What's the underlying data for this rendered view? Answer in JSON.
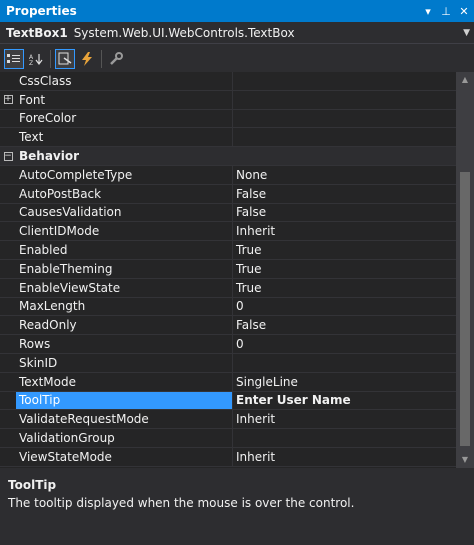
{
  "window": {
    "title": "Properties"
  },
  "object": {
    "name": "TextBox1",
    "type": "System.Web.UI.WebControls.TextBox"
  },
  "rows": [
    {
      "name": "CssClass",
      "value": ""
    },
    {
      "name": "Font",
      "value": "",
      "expandable": true
    },
    {
      "name": "ForeColor",
      "value": ""
    },
    {
      "name": "Text",
      "value": ""
    },
    {
      "name": "Behavior",
      "value": "",
      "category": true
    },
    {
      "name": "AutoCompleteType",
      "value": "None"
    },
    {
      "name": "AutoPostBack",
      "value": "False"
    },
    {
      "name": "CausesValidation",
      "value": "False"
    },
    {
      "name": "ClientIDMode",
      "value": "Inherit"
    },
    {
      "name": "Enabled",
      "value": "True"
    },
    {
      "name": "EnableTheming",
      "value": "True"
    },
    {
      "name": "EnableViewState",
      "value": "True"
    },
    {
      "name": "MaxLength",
      "value": "0"
    },
    {
      "name": "ReadOnly",
      "value": "False"
    },
    {
      "name": "Rows",
      "value": "0"
    },
    {
      "name": "SkinID",
      "value": ""
    },
    {
      "name": "TextMode",
      "value": "SingleLine"
    },
    {
      "name": "ToolTip",
      "value": "Enter User Name",
      "selected": true
    },
    {
      "name": "ValidateRequestMode",
      "value": "Inherit"
    },
    {
      "name": "ValidationGroup",
      "value": ""
    },
    {
      "name": "ViewStateMode",
      "value": "Inherit"
    }
  ],
  "description": {
    "title": "ToolTip",
    "text": "The tooltip displayed when the mouse is over the control."
  },
  "colors": {
    "accent": "#007acc",
    "selection": "#3399ff",
    "background": "#252526"
  }
}
